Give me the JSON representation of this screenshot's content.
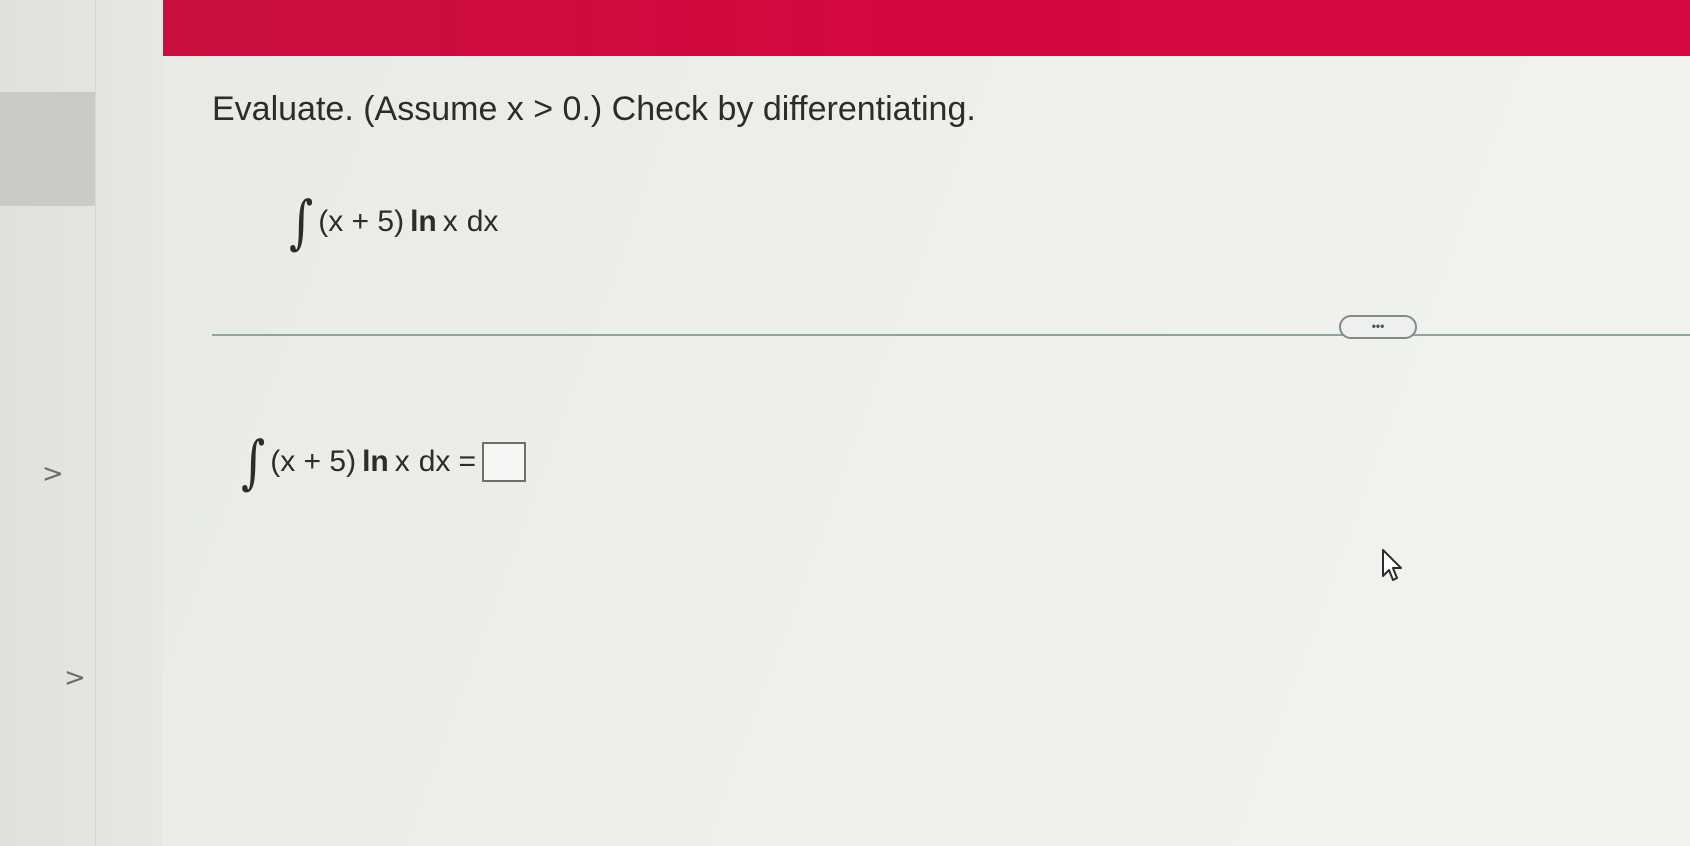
{
  "instruction": "Evaluate. (Assume x > 0.) Check by differentiating.",
  "problem": {
    "integral_sign": "∫",
    "expression": "(x + 5)",
    "ln": "ln",
    "variable": "x",
    "differential": "dx"
  },
  "answer": {
    "integral_sign": "∫",
    "expression": "(x + 5)",
    "ln": "ln",
    "variable": "x",
    "differential": "dx",
    "equals": "="
  },
  "more_button": {
    "label": "•••"
  },
  "nav": {
    "chevron_1": ">",
    "chevron_2": ">"
  },
  "colors": {
    "header": "#d4083f",
    "text": "#2c2d2b",
    "divider": "#8fa3a5"
  },
  "icons": {
    "cursor": "mouse-pointer-icon",
    "chevron": "chevron-right-icon"
  }
}
